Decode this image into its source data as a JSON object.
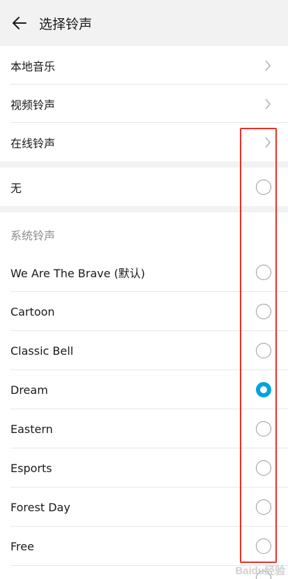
{
  "header": {
    "title": "选择铃声",
    "back_icon": "arrow-left-icon"
  },
  "nav_items": [
    {
      "label": "本地音乐",
      "icon": "chevron-right-icon"
    },
    {
      "label": "视频铃声",
      "icon": "chevron-right-icon"
    },
    {
      "label": "在线铃声",
      "icon": "chevron-right-icon"
    }
  ],
  "none_option": {
    "label": "无",
    "selected": false
  },
  "system_section": {
    "title": "系统铃声",
    "ringtones": [
      {
        "label": "We Are The Brave (默认)",
        "selected": false
      },
      {
        "label": "Cartoon",
        "selected": false
      },
      {
        "label": "Classic Bell",
        "selected": false
      },
      {
        "label": "Dream",
        "selected": true
      },
      {
        "label": "Eastern",
        "selected": false
      },
      {
        "label": "Esports",
        "selected": false
      },
      {
        "label": "Forest Day",
        "selected": false
      },
      {
        "label": "Free",
        "selected": false
      }
    ]
  },
  "colors": {
    "accent": "#00a3e0",
    "highlight_box": "#e8302a",
    "background_gray": "#f2f2f2"
  },
  "watermark": "Baidu经验"
}
